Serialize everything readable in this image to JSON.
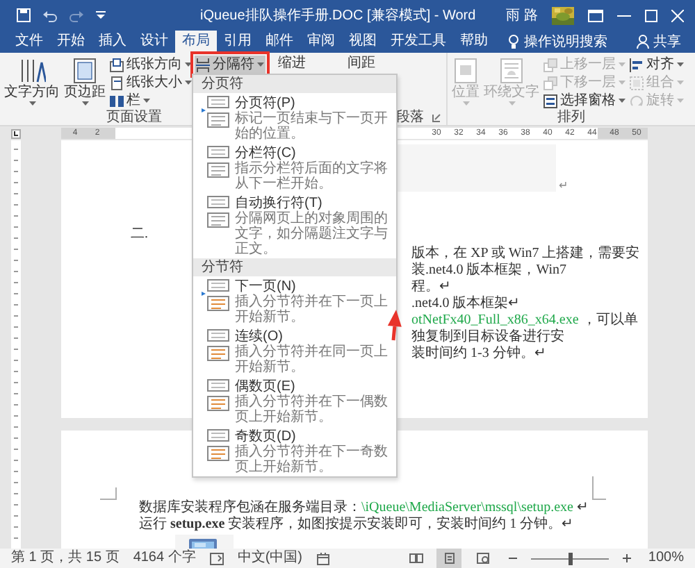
{
  "window": {
    "title": "iQueue排队操作手册.DOC [兼容模式] - Word",
    "user": "雨 路"
  },
  "tabs": [
    {
      "label": "文件",
      "selected": false
    },
    {
      "label": "开始",
      "selected": false
    },
    {
      "label": "插入",
      "selected": false
    },
    {
      "label": "设计",
      "selected": false
    },
    {
      "label": "布局",
      "selected": true
    },
    {
      "label": "引用",
      "selected": false
    },
    {
      "label": "邮件",
      "selected": false
    },
    {
      "label": "审阅",
      "selected": false
    },
    {
      "label": "视图",
      "selected": false
    },
    {
      "label": "开发工具",
      "selected": false
    },
    {
      "label": "帮助",
      "selected": false
    }
  ],
  "tell_me": "操作说明搜索",
  "share": "共享",
  "ribbon": {
    "page_setup": {
      "label": "页面设置",
      "items": [
        {
          "kind": "large",
          "label": "文字方向",
          "pressed": false
        },
        {
          "kind": "large",
          "label": "页边距",
          "pressed": false
        },
        {
          "kind": "small",
          "label": "纸张方向",
          "pressed": false
        },
        {
          "kind": "small",
          "label": "纸张大小",
          "pressed": false
        },
        {
          "kind": "small",
          "label": "栏",
          "pressed": false
        },
        {
          "kind": "small",
          "label": "分隔符",
          "pressed": true
        }
      ]
    },
    "paragraph": {
      "label": "段落",
      "headers": [
        "缩进",
        "间距"
      ]
    },
    "arrange": {
      "label": "排列",
      "items": [
        {
          "kind": "large",
          "label": "位置",
          "disabled": true
        },
        {
          "kind": "large",
          "label": "环绕文字",
          "disabled": true
        },
        {
          "kind": "small",
          "label": "上移一层",
          "disabled": true
        },
        {
          "kind": "small",
          "label": "下移一层",
          "disabled": true
        },
        {
          "kind": "small",
          "label": "选择窗格",
          "disabled": false
        },
        {
          "kind": "small",
          "label": "对齐",
          "disabled": false
        },
        {
          "kind": "small",
          "label": "组合",
          "disabled": true
        },
        {
          "kind": "small",
          "label": "旋转",
          "disabled": true
        }
      ]
    }
  },
  "ruler": {
    "left_ticks": [
      "4",
      "2"
    ],
    "right_ticks": [
      "30",
      "32",
      "34",
      "36",
      "38",
      "40",
      "42",
      "44",
      "48",
      "50"
    ]
  },
  "document": {
    "pages": [
      {
        "image_mark": "↵",
        "heading": "二.",
        "lines": [
          [
            {
              "kind": "plain",
              "text": "版本，在 XP 或 Win7 上搭建，需要安装.net4.0 版本框架，Win7"
            }
          ],
          [
            {
              "kind": "plain",
              "text": "程。↵"
            }
          ],
          [
            {
              "kind": "plain",
              "text": ".net4.0 版本框架↵"
            }
          ],
          [
            {
              "kind": "path",
              "text": "otNetFx40_Full_x86_x64.exe"
            },
            {
              "kind": "plain",
              "text": " ，可以单独复制到目标设备进行安"
            }
          ],
          [
            {
              "kind": "plain",
              "text": "装时间约 1-3 分钟。↵"
            }
          ]
        ]
      },
      {
        "lines": [
          [
            {
              "kind": "plain",
              "text": "数据库安装程序包涵在服务端目录："
            },
            {
              "kind": "path",
              "text": "\\iQueue\\MediaServer\\mssql\\setup.exe"
            },
            {
              "kind": "plain",
              "text": " ↵"
            }
          ],
          [
            {
              "kind": "plain",
              "text": "运行 **setup.exe** 安装程序，如图按提示安装即可，安装时间约 1 分钟。↵"
            }
          ]
        ]
      }
    ]
  },
  "break_menu": {
    "sections": [
      {
        "header": "分页符",
        "items": [
          {
            "title": "分页符(P)",
            "description": "标记一页结束与下一页开始的位置。"
          },
          {
            "title": "分栏符(C)",
            "description": "指示分栏符后面的文字将从下一栏开始。"
          },
          {
            "title": "自动换行符(T)",
            "description": "分隔网页上的对象周围的文字，如分隔题注文字与正文。"
          }
        ]
      },
      {
        "header": "分节符",
        "items": [
          {
            "title": "下一页(N)",
            "description": "插入分节符并在下一页上开始新节。"
          },
          {
            "title": "连续(O)",
            "description": "插入分节符并在同一页上开始新节。"
          },
          {
            "title": "偶数页(E)",
            "description": "插入分节符并在下一偶数页上开始新节。"
          },
          {
            "title": "奇数页(D)",
            "description": "插入分节符并在下一奇数页上开始新节。"
          }
        ]
      }
    ]
  },
  "status_bar": {
    "page": "第 1 页，共 15 页",
    "words": "4164 个字",
    "language": "中文(中国)",
    "views": [
      {
        "selected": false
      },
      {
        "selected": true
      },
      {
        "selected": false
      }
    ],
    "zoom": {
      "level": 0.5
    },
    "zoom_label": "100%"
  }
}
